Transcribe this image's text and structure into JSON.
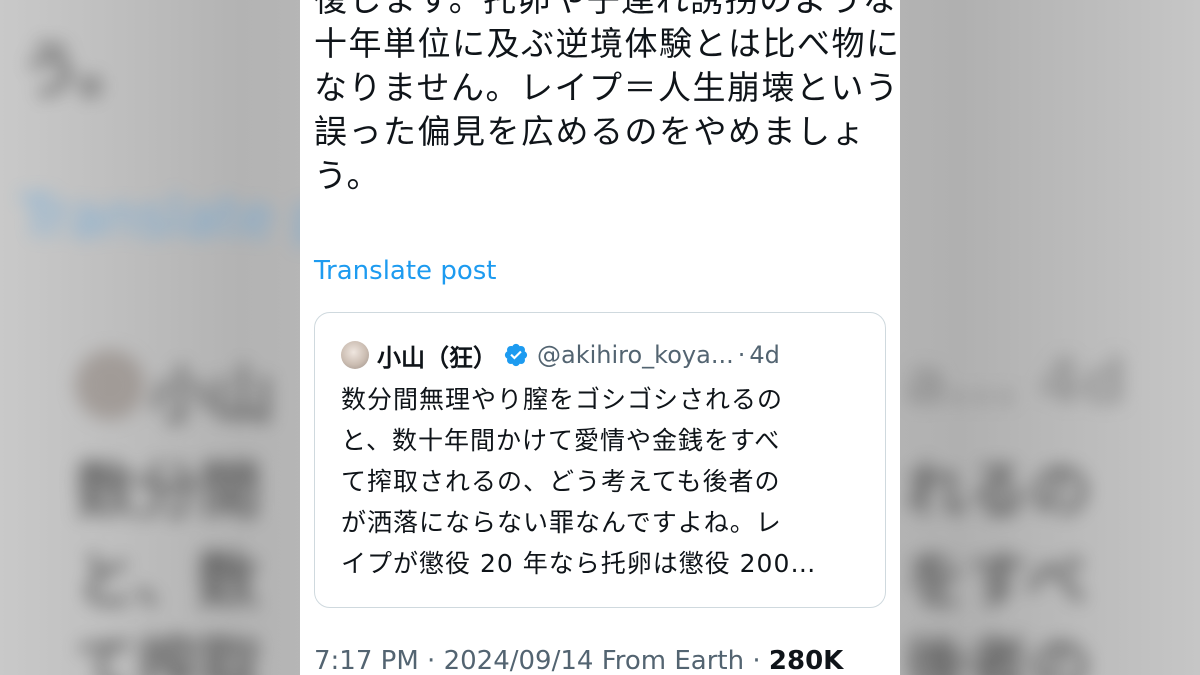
{
  "post": {
    "text_lines": [
      "復します。托卵や子連れ誘拐のような",
      "十年単位に及ぶ逆境体験とは比べ物に",
      "なりません。レイプ＝人生崩壊という",
      "誤った偏見を広めるのをやめましょ",
      "う。"
    ],
    "translate_label": "Translate post",
    "meta": {
      "time": "7:17 PM",
      "date": "2024/09/14",
      "source": "From Earth",
      "views": "280K"
    }
  },
  "quote": {
    "author_name": "小山（狂）",
    "handle": "@akihiro_koya...",
    "time_ago": "4d",
    "text_lines": [
      "数分間無理やり膣をゴシゴシされるの",
      "と、数十年間かけて愛情や金銭をすべ",
      "て搾取されるの、どう考えても後者の",
      "が洒落にならない罪なんですよね。レ",
      "イプが懲役 20 年なら托卵は懲役 200…"
    ]
  },
  "background": {
    "fragments": [
      "う。",
      "Translate p",
      "小山",
      "a... 4d",
      "数分間",
      "れるの",
      "と、数",
      "をすべ",
      "て搾取",
      "後者の"
    ]
  },
  "colors": {
    "link": "#1d9bf0",
    "text": "#0f1419",
    "muted": "#536471",
    "border": "#cfd9de",
    "verified": "#1d9bf0"
  },
  "icons": {
    "verified_badge": "verified-badge-icon",
    "avatar": "avatar"
  }
}
